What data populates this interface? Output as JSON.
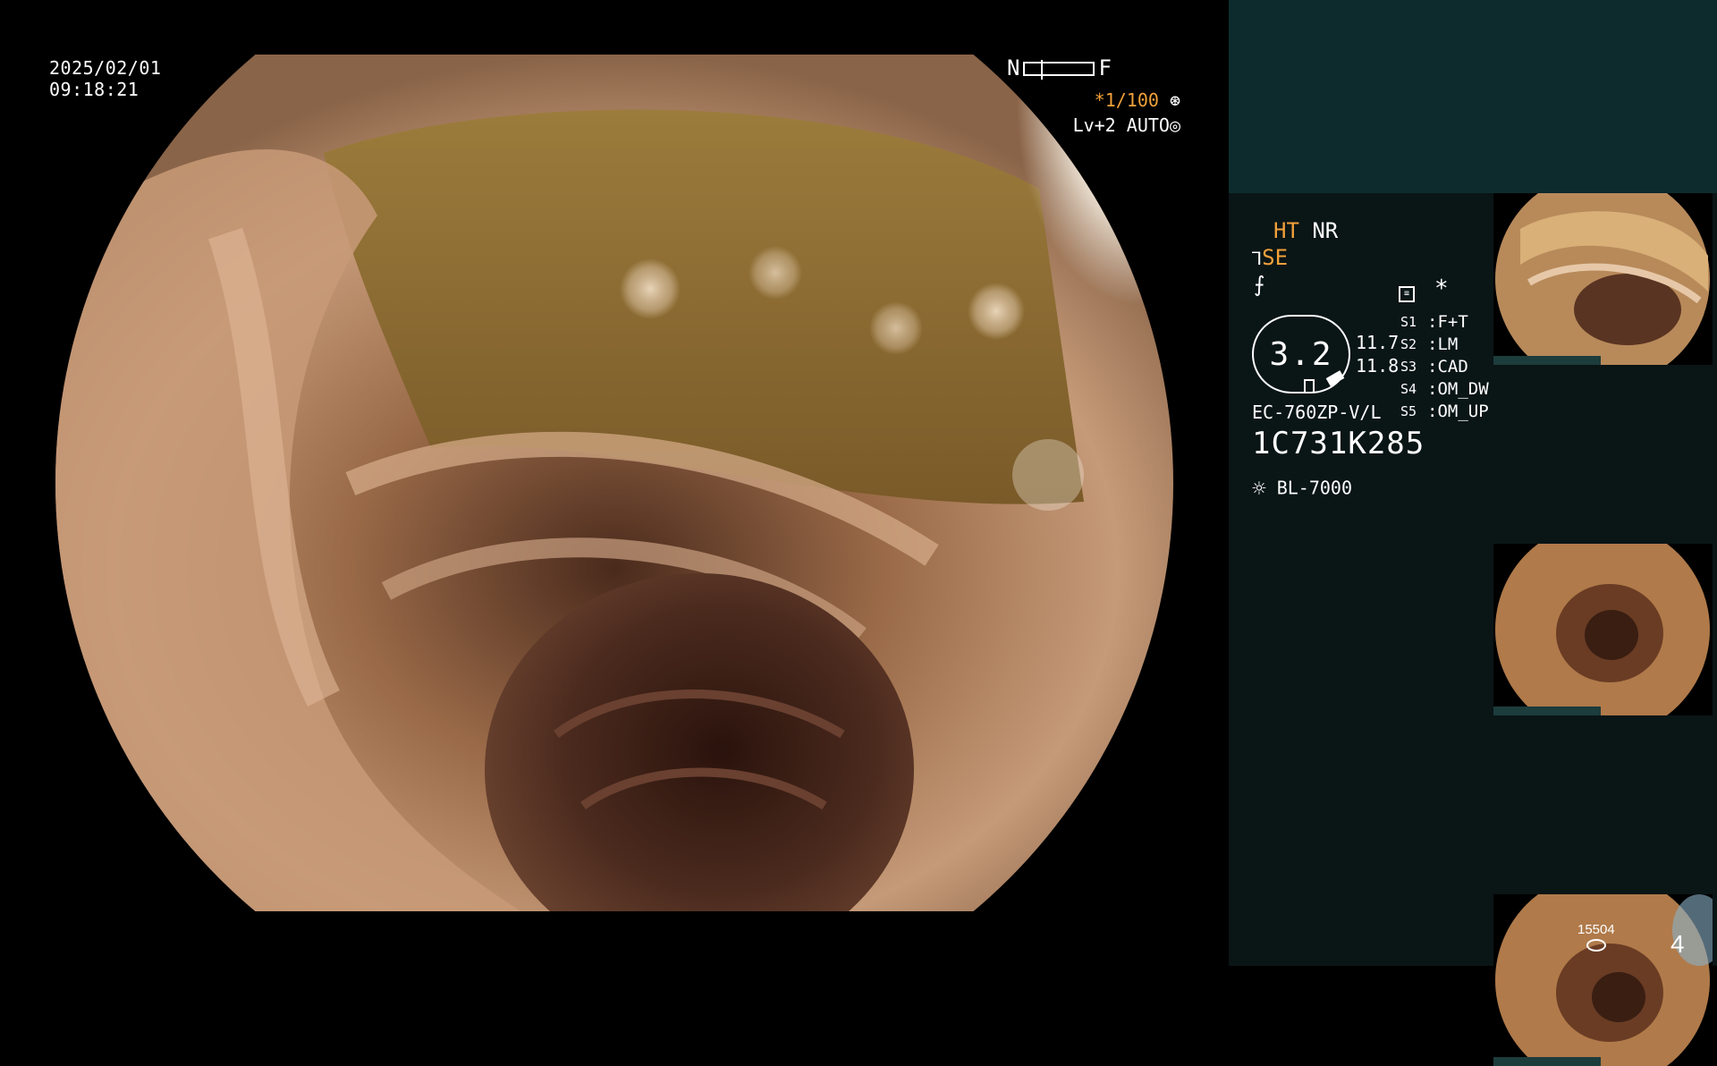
{
  "overlay": {
    "date": "2025/02/01",
    "time": "09:18:21",
    "nf_left": "N",
    "nf_right": "F",
    "shutter": "*1/100",
    "level": "Lv+2",
    "mode": "AUTO"
  },
  "panel": {
    "ht": "HT",
    "nr": "NR",
    "se": "SE",
    "star": "*",
    "magnification": "3.2",
    "value_upper": "11.7",
    "value_lower": "11.8",
    "scope_model": "EC-760ZP-V/L",
    "serial": "1C731K285",
    "light_source": "BL-7000",
    "switches": [
      {
        "key": "S1",
        "value": "F+T"
      },
      {
        "key": "S2",
        "value": "LM"
      },
      {
        "key": "S3",
        "value": "CAD"
      },
      {
        "key": "S4",
        "value": "OM_DW"
      },
      {
        "key": "S5",
        "value": "OM_UP"
      }
    ],
    "storage_count": "15504",
    "image_count": "4"
  },
  "colors": {
    "panel_top": "#0d2b2d",
    "panel_bottom": "#0a1516",
    "accent": "#f2a13a"
  }
}
